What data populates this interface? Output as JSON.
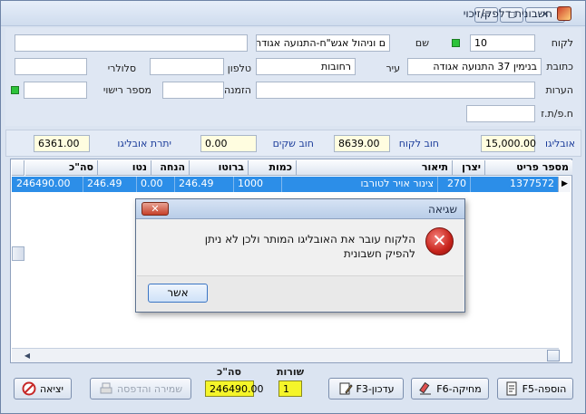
{
  "window": {
    "title": "חשבונית דלפק/זיכוי",
    "buttons": {
      "minimize": "▭",
      "maximize": "◻",
      "close": "✕"
    }
  },
  "header": {
    "customer_label": "לקוח",
    "customer_number": "10",
    "name_label": "שם",
    "customer_name": "ם וניהול אגש\"ח-התנועה אגודה",
    "address_label": "כתובת",
    "address_value": "בנימין 37 התנועה אגודה",
    "city_label": "עיר",
    "city_value": "רחובות",
    "phone_label": "טלפון",
    "phone_value": "",
    "mobile_label": "סלולרי",
    "mobile_value": "",
    "notes_label": "הערות",
    "notes_value": "",
    "order_label": "הזמנה",
    "order_value": "",
    "license_label": "מספר רישוי",
    "license_value": "",
    "id_label": "ח.פ/ת.ז",
    "id_value": ""
  },
  "summary": {
    "obligo_label": "אובליגו",
    "obligo_value": "15,000.00",
    "customer_debt_label": "חוב לקוח",
    "customer_debt_value": "8639.00",
    "checks_debt_label": "חוב שקים",
    "checks_debt_value": "0.00",
    "obligo_balance_label": "יתרת אובליגו",
    "obligo_balance_value": "6361.00"
  },
  "grid": {
    "columns": [
      "מספר פריט",
      "יצרן",
      "תיאור",
      "כמות",
      "ברוטו",
      "הנחה",
      "נטו",
      "סה\"כ"
    ],
    "rows": [
      [
        "1377572",
        "270",
        "צינור אויר לטורבו",
        "1000",
        "246.49",
        "0.00",
        "246.49",
        "246490.00"
      ]
    ]
  },
  "dialog": {
    "title": "שגיאה",
    "close_label": "✕",
    "icon": "error-icon",
    "message": "הלקוח עובר את האובליגו המותר ולכן לא ניתן להפיק חשבונית",
    "ok_label": "אשר"
  },
  "footer": {
    "rows_label": "שורות",
    "rows_value": "1",
    "total_label": "סה\"כ",
    "total_value": "246490.00",
    "buttons": {
      "add": "הוספה-F5",
      "delete": "מחיקה-F6",
      "update": "עדכון-F3",
      "save_print": "שמירה והדפסה",
      "exit": "יציאה"
    }
  }
}
